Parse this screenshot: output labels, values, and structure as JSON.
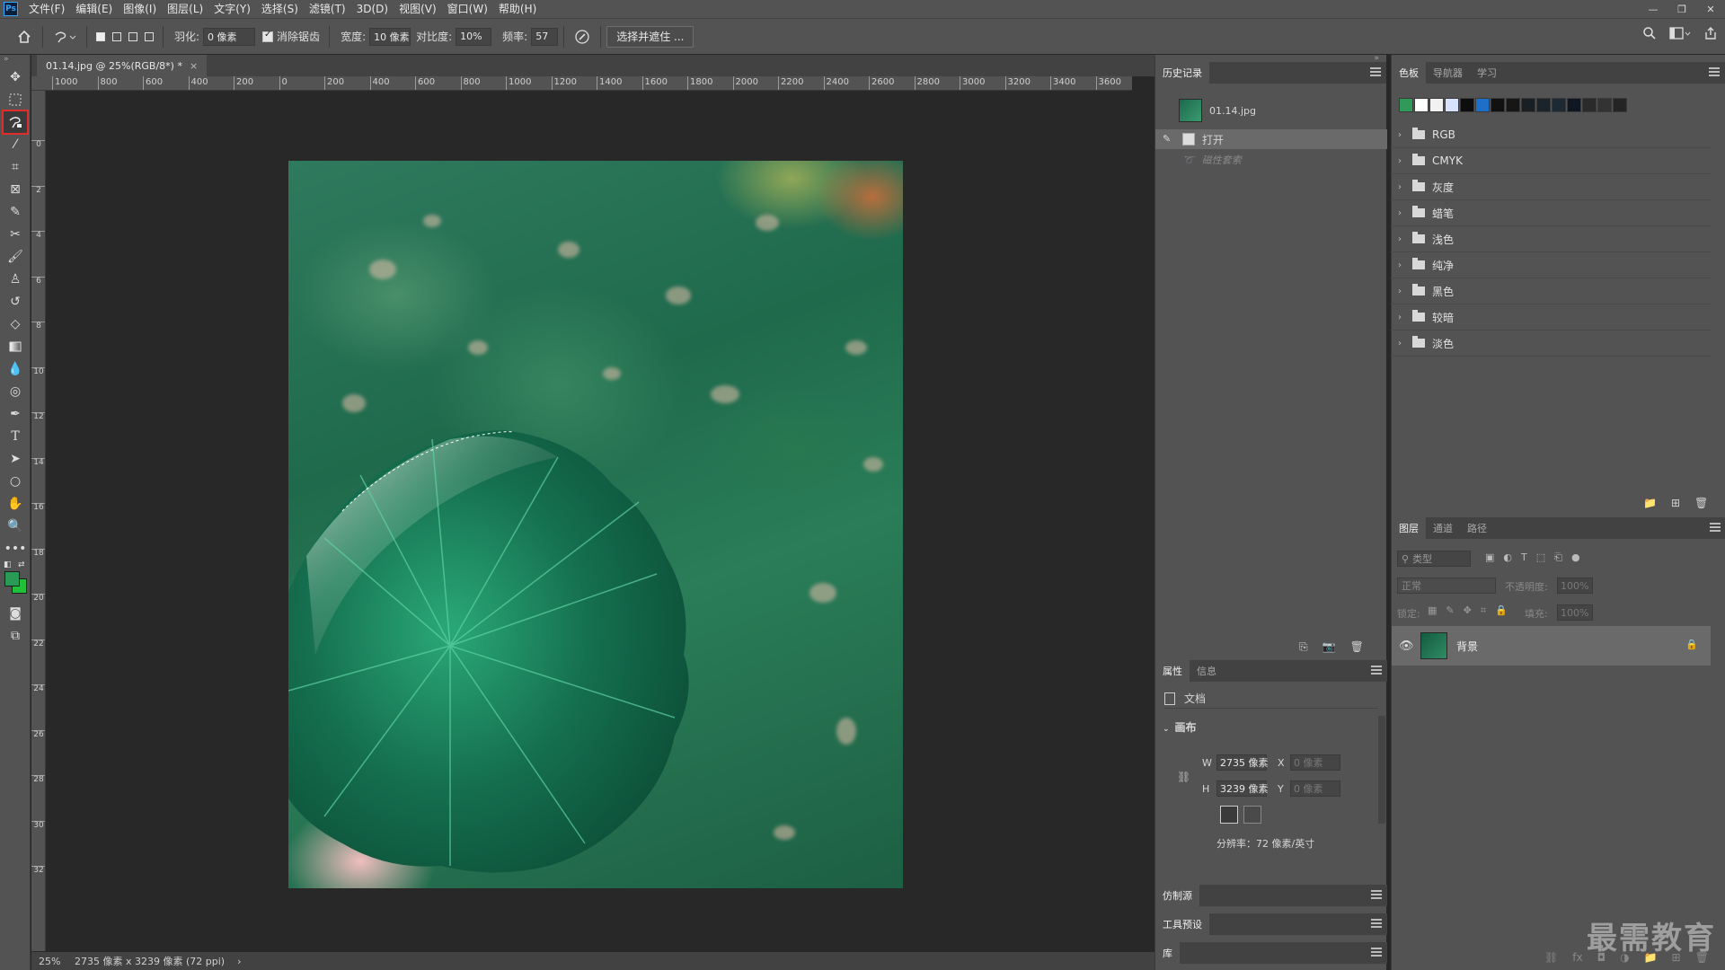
{
  "menubar": {
    "logo": "Ps",
    "items": [
      "文件(F)",
      "编辑(E)",
      "图像(I)",
      "图层(L)",
      "文字(Y)",
      "选择(S)",
      "滤镜(T)",
      "3D(D)",
      "视图(V)",
      "窗口(W)",
      "帮助(H)"
    ]
  },
  "window_controls": {
    "minimize": "—",
    "restore": "❐",
    "close": "✕"
  },
  "options": {
    "feather_label": "羽化:",
    "feather_value": "0 像素",
    "antialias_label": "消除锯齿",
    "width_label": "宽度:",
    "width_value": "10 像素",
    "contrast_label": "对比度:",
    "contrast_value": "10%",
    "frequency_label": "频率:",
    "frequency_value": "57",
    "select_mask_button": "选择并遮住 ..."
  },
  "document": {
    "tab_title": "01.14.jpg @ 25%(RGB/8*) *",
    "tab_close": "×"
  },
  "hruler_labels": [
    "1000",
    "800",
    "600",
    "400",
    "200",
    "0",
    "200",
    "400",
    "600",
    "800",
    "1000",
    "1200",
    "1400",
    "1600",
    "1800",
    "2000",
    "2200",
    "2400",
    "2600",
    "2800",
    "3000",
    "3200",
    "3400",
    "3600"
  ],
  "vruler_labels": [
    "0",
    "2",
    "4",
    "6",
    "8",
    "10",
    "12",
    "14",
    "16",
    "18",
    "20",
    "22",
    "24",
    "26",
    "28",
    "30",
    "32"
  ],
  "history": {
    "tab": "历史记录",
    "snapshot_name": "01.14.jpg",
    "steps": [
      {
        "label": "打开"
      },
      {
        "label": "磁性套索"
      }
    ]
  },
  "properties": {
    "tabs": [
      "属性",
      "信息"
    ],
    "doc_label": "文档",
    "canvas_section": "画布",
    "w_label": "W",
    "w_value": "2735 像素",
    "h_label": "H",
    "h_value": "3239 像素",
    "x_label": "X",
    "x_value": "0 像素",
    "y_label": "Y",
    "y_value": "0 像素",
    "resolution": "分辨率：72 像素/英寸"
  },
  "collapsed_panels": [
    "仿制源",
    "工具预设",
    "库"
  ],
  "swatches_panel": {
    "tabs": [
      "色板",
      "导航器",
      "学习"
    ],
    "colors": [
      "#2f9a5a",
      "#ffffff",
      "#f2f2f2",
      "#d6e2ff",
      "#0d0d0d",
      "#1e6fc8",
      "#111111",
      "#161616",
      "#1a1f24",
      "#1b232b",
      "#1e2a33",
      "#0f1822",
      "#2a2a2a",
      "#333333",
      "#242424"
    ],
    "folders": [
      "RGB",
      "CMYK",
      "灰度",
      "蜡笔",
      "浅色",
      "纯净",
      "黑色",
      "较暗",
      "淡色"
    ]
  },
  "layers_panel": {
    "tabs": [
      "图层",
      "通道",
      "路径"
    ],
    "search_placeholder": "类型",
    "blend_mode": "正常",
    "opacity_label": "不透明度:",
    "opacity_value": "100%",
    "lock_label": "锁定:",
    "fill_label": "填充:",
    "fill_value": "100%",
    "layer_name": "背景"
  },
  "status": {
    "zoom": "25%",
    "doc_info": "2735 像素 x 3239 像素 (72 ppi)",
    "arrow": "›"
  },
  "watermark": "最需教育",
  "colors": {
    "foreground": "#2a9b57",
    "background": "#21c03a",
    "selected_tool_outline": "#e02c2c"
  }
}
